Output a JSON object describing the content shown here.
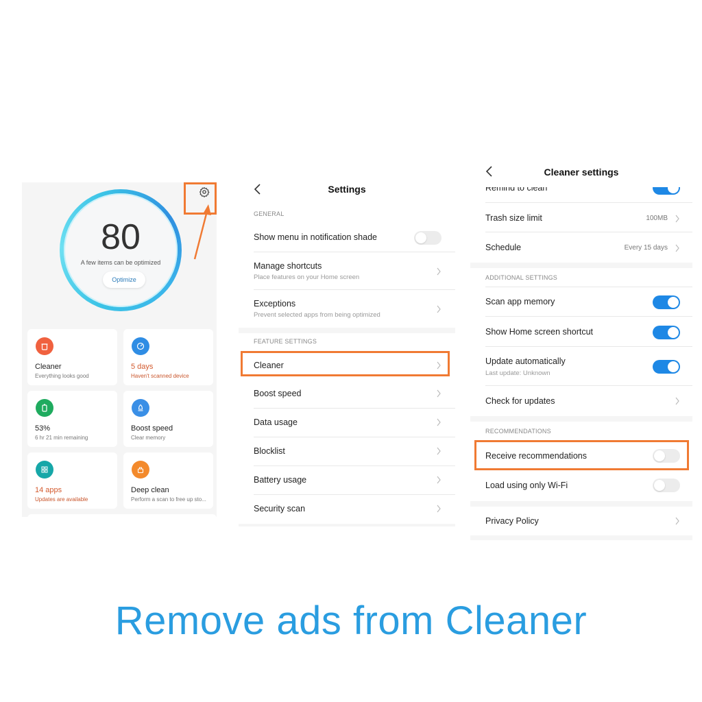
{
  "caption": "Remove ads from Cleaner",
  "colors": {
    "highlight": "#f07a33",
    "accent_blue": "#1e88e5",
    "caption_blue": "#2a9de0",
    "warning_text": "#d35a2e"
  },
  "home": {
    "score": "80",
    "score_subtitle": "A few items can be optimized",
    "optimize_button": "Optimize",
    "settings_icon": "gear-icon",
    "cards": [
      {
        "icon": "trash-icon",
        "icon_color": "#f0613f",
        "title": "Cleaner",
        "subtitle": "Everything looks good",
        "warning": false
      },
      {
        "icon": "shield-scan-icon",
        "icon_color": "#2f8de4",
        "title": "5 days",
        "subtitle": "Haven't scanned device",
        "warning": true
      },
      {
        "icon": "battery-icon",
        "icon_color": "#1fab5f",
        "title": "53%",
        "subtitle": "6 hr 21 min  remaining",
        "warning": false
      },
      {
        "icon": "rocket-icon",
        "icon_color": "#3a8fe6",
        "title": "Boost speed",
        "subtitle": "Clear memory",
        "warning": false
      },
      {
        "icon": "apps-icon",
        "icon_color": "#16a7a8",
        "title": "14 apps",
        "subtitle": "Updates are available",
        "warning": true
      },
      {
        "icon": "broom-icon",
        "icon_color": "#f38a2c",
        "title": "Deep clean",
        "subtitle": "Perform a scan to free up sto...",
        "warning": false
      }
    ]
  },
  "settings": {
    "title": "Settings",
    "general_header": "GENERAL",
    "general": [
      {
        "label": "Show menu in notification shade",
        "toggle": false
      },
      {
        "label": "Manage shortcuts",
        "subtitle": "Place features on your Home screen"
      },
      {
        "label": "Exceptions",
        "subtitle": "Prevent selected apps from being optimized"
      }
    ],
    "feature_header": "FEATURE SETTINGS",
    "features": [
      {
        "label": "Cleaner",
        "highlighted": true
      },
      {
        "label": "Boost speed"
      },
      {
        "label": "Data usage"
      },
      {
        "label": "Blocklist"
      },
      {
        "label": "Battery usage"
      },
      {
        "label": "Security scan"
      }
    ]
  },
  "cleaner_settings": {
    "title": "Cleaner settings",
    "top_rows": [
      {
        "label": "Remind to clean",
        "toggle": true
      },
      {
        "label": "Trash size limit",
        "value": "100MB"
      },
      {
        "label": "Schedule",
        "value": "Every 15 days"
      }
    ],
    "additional_header": "ADDITIONAL SETTINGS",
    "additional": [
      {
        "label": "Scan app memory",
        "toggle": true
      },
      {
        "label": "Show Home screen shortcut",
        "toggle": true
      },
      {
        "label": "Update automatically",
        "subtitle": "Last update: Unknown",
        "toggle": true
      },
      {
        "label": "Check for updates"
      }
    ],
    "recommendations_header": "RECOMMENDATIONS",
    "recommendations": [
      {
        "label": "Receive recommendations",
        "toggle": false,
        "highlighted": true
      },
      {
        "label": "Load using only Wi-Fi",
        "toggle": false
      }
    ],
    "privacy_policy": "Privacy Policy"
  }
}
